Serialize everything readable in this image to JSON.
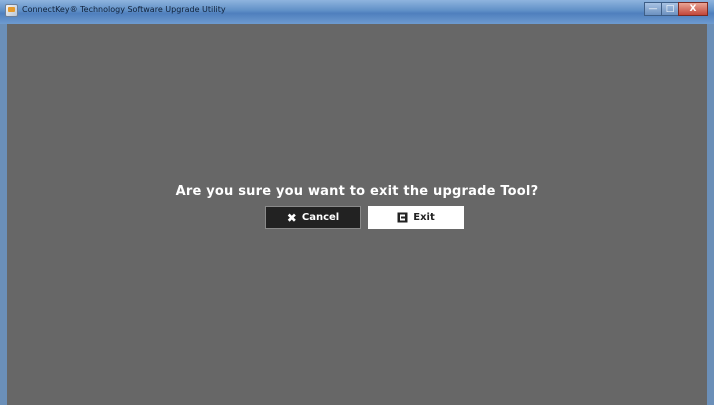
{
  "window": {
    "title": "ConnectKey® Technology Software Upgrade Utility",
    "controls": {
      "minimize": "—",
      "maximize": "□",
      "close": "X"
    }
  },
  "dialog": {
    "question": "Are you sure you want to exit the upgrade Tool?",
    "cancel_label": "Cancel",
    "cancel_icon": "close-x-icon",
    "exit_label": "Exit",
    "exit_icon": "exit-door-icon"
  },
  "colors": {
    "background": "#676767",
    "cancel_button": "#222222",
    "exit_button": "#ffffff",
    "text": "#ffffff"
  }
}
